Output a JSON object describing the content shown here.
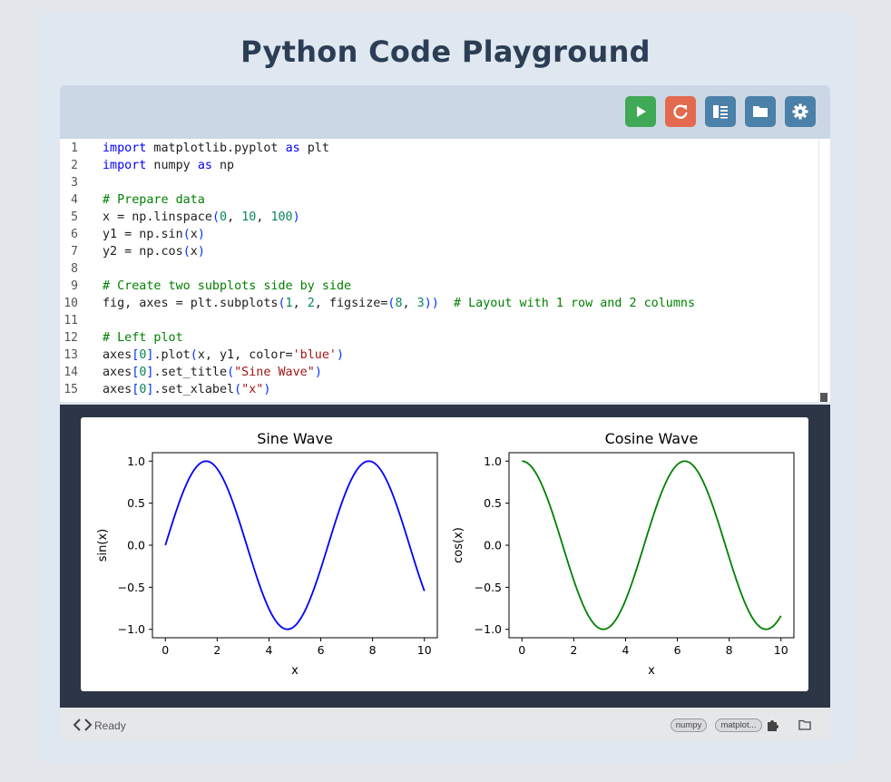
{
  "page": {
    "title": "Python Code Playground"
  },
  "toolbar": {
    "buttons": [
      {
        "icon": "play-icon",
        "color": "#3fa955"
      },
      {
        "icon": "refresh-icon",
        "color": "#e26a4f"
      },
      {
        "icon": "split-view-icon",
        "color": "#4b80a8"
      },
      {
        "icon": "folder-icon",
        "color": "#4b80a8"
      },
      {
        "icon": "gear-icon",
        "color": "#4b80a8"
      }
    ]
  },
  "editor": {
    "lines": [
      {
        "n": "1",
        "html": "<span class='kw'>import</span> matplotlib.pyplot <span class='kw'>as</span> plt"
      },
      {
        "n": "2",
        "html": "<span class='kw'>import</span> numpy <span class='kw'>as</span> np"
      },
      {
        "n": "3",
        "html": ""
      },
      {
        "n": "4",
        "html": "<span class='cm'># Prepare data</span>"
      },
      {
        "n": "5",
        "html": "x = np.linspace<span class='br'>(</span><span class='nm'>0</span>, <span class='nm'>10</span>, <span class='nm'>100</span><span class='br'>)</span>"
      },
      {
        "n": "6",
        "html": "y1 = np.sin<span class='br'>(</span>x<span class='br'>)</span>"
      },
      {
        "n": "7",
        "html": "y2 = np.cos<span class='br'>(</span>x<span class='br'>)</span>"
      },
      {
        "n": "8",
        "html": ""
      },
      {
        "n": "9",
        "html": "<span class='cm'># Create two subplots side by side</span>"
      },
      {
        "n": "10",
        "html": "fig, axes = plt.subplots<span class='br'>(</span><span class='nm'>1</span>, <span class='nm'>2</span>, figsize=<span class='br'>(</span><span class='nm'>8</span>, <span class='nm'>3</span><span class='br'>))</span>  <span class='cm'># Layout with 1 row and 2 columns</span>"
      },
      {
        "n": "11",
        "html": ""
      },
      {
        "n": "12",
        "html": "<span class='cm'># Left plot</span>"
      },
      {
        "n": "13",
        "html": "axes<span class='br'>[</span><span class='nm'>0</span><span class='br'>]</span>.plot<span class='br'>(</span>x, y1, color=<span class='st'>'blue'</span><span class='br'>)</span>"
      },
      {
        "n": "14",
        "html": "axes<span class='br'>[</span><span class='nm'>0</span><span class='br'>]</span>.set_title<span class='br'>(</span><span class='st'>\"Sine Wave\"</span><span class='br'>)</span>"
      },
      {
        "n": "15",
        "html": "axes<span class='br'>[</span><span class='nm'>0</span><span class='br'>]</span>.set_xlabel<span class='br'>(</span><span class='st'>\"x\"</span><span class='br'>)</span>"
      }
    ]
  },
  "chart_data": [
    {
      "type": "line",
      "title": "Sine Wave",
      "xlabel": "x",
      "ylabel": "sin(x)",
      "xlim": [
        -0.5,
        10.5
      ],
      "ylim": [
        -1.1,
        1.1
      ],
      "xticks": [
        "0",
        "2",
        "4",
        "6",
        "8",
        "10"
      ],
      "yticks": [
        "1.0",
        "0.5",
        "0.0",
        "−0.5",
        "−1.0"
      ],
      "series": [
        {
          "function": "sin",
          "x_range": [
            0,
            10
          ],
          "points": 100,
          "color": "#0000ff"
        }
      ]
    },
    {
      "type": "line",
      "title": "Cosine Wave",
      "xlabel": "x",
      "ylabel": "cos(x)",
      "xlim": [
        -0.5,
        10.5
      ],
      "ylim": [
        -1.1,
        1.1
      ],
      "xticks": [
        "0",
        "2",
        "4",
        "6",
        "8",
        "10"
      ],
      "yticks": [
        "1.0",
        "0.5",
        "0.0",
        "−0.5",
        "−1.0"
      ],
      "series": [
        {
          "function": "cos",
          "x_range": [
            0,
            10
          ],
          "points": 100,
          "color": "#008000"
        }
      ]
    }
  ],
  "status": {
    "text": "Ready",
    "packages": [
      "numpy",
      "matplot..."
    ]
  }
}
